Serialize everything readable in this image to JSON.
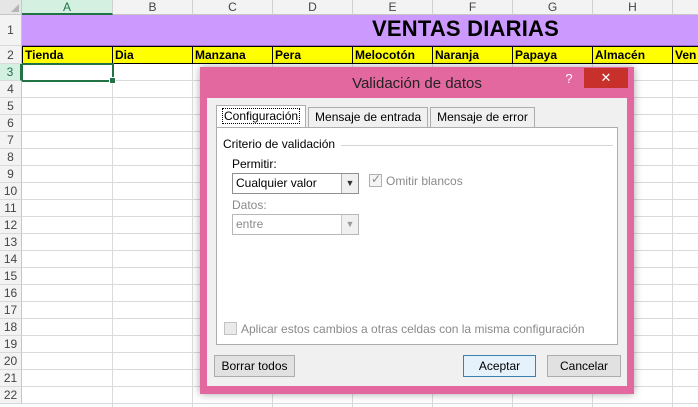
{
  "sheet": {
    "columns": [
      "A",
      "B",
      "C",
      "D",
      "E",
      "F",
      "G",
      "H"
    ],
    "rows": [
      "1",
      "2",
      "3",
      "4",
      "5",
      "6",
      "7",
      "8",
      "9",
      "10",
      "11",
      "12",
      "13",
      "14",
      "15",
      "16",
      "17",
      "18",
      "19",
      "20",
      "21",
      "22"
    ],
    "title": "VENTAS DIARIAS",
    "headers": [
      "Tienda",
      "Dia",
      "Manzana",
      "Pera",
      "Melocotón",
      "Naranja",
      "Papaya",
      "Almacén",
      "Ven"
    ],
    "selected_cell": "A3",
    "colors": {
      "title_fill": "#cc99ff",
      "header_fill": "#ffff00",
      "selection": "#217346"
    }
  },
  "dialog": {
    "title": "Validación de datos",
    "help_label": "?",
    "close_label": "✕",
    "frame_color": "#e2689f",
    "tabs": [
      "Configuración",
      "Mensaje de entrada",
      "Mensaje de error"
    ],
    "active_tab": "Configuración",
    "group_label": "Criterio de validación",
    "allow_label": "Permitir:",
    "allow_value": "Cualquier valor",
    "ignore_blank_label": "Omitir blancos",
    "data_label": "Datos:",
    "data_value": "entre",
    "apply_all_label": "Aplicar estos cambios a otras celdas con la misma configuración",
    "clear_all_label": "Borrar todos",
    "ok_label": "Aceptar",
    "cancel_label": "Cancelar"
  }
}
